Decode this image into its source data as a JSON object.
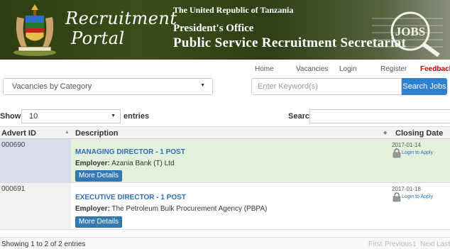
{
  "banner": {
    "portal_title_line1": "Recruitment",
    "portal_title_line2": "Portal",
    "gov_line1": "The United Republic of Tanzania",
    "gov_line2": "President's Office",
    "gov_line3": "Public Service Recruitment Secretariat",
    "jobs_art_text": "JOBS"
  },
  "nav": {
    "home": "Home",
    "vacancies": "Vacancies",
    "login": "Login",
    "register": "Register",
    "feedback": "Feedback"
  },
  "filters": {
    "category_selected": "Vacancies by Category",
    "keyword_placeholder": "Enter Keyword(s)",
    "search_button": "Search Jobs"
  },
  "table_controls": {
    "show_label": "Show",
    "page_length": "10",
    "entries_label": "entries",
    "search_label": "Search:"
  },
  "table": {
    "headers": {
      "advert_id": "Advert ID",
      "description": "Description",
      "closing_date": "Closing Date"
    },
    "rows": [
      {
        "advert_id": "000690",
        "title": "MANAGING DIRECTOR - 1 POST",
        "employer_label": "Employer:",
        "employer": "Azania Bank (T) Ltd",
        "more_details": "More Details",
        "closing_date": "2017-01-14",
        "login_to_apply": "Login to Apply"
      },
      {
        "advert_id": "000691",
        "title": "EXECUTIVE DIRECTOR - 1 POST",
        "employer_label": "Employer:",
        "employer": "The Petroleum Bulk Procurement Agency (PBPA)",
        "more_details": "More Details",
        "closing_date": "2017-01-18",
        "login_to_apply": "Login to Apply"
      }
    ]
  },
  "footer": {
    "info": "Showing 1 to 2 of 2 entries",
    "first": "First",
    "previous": "Previous",
    "page": "1",
    "next": "Next",
    "last": "Last"
  },
  "colors": {
    "accent_blue": "#2f80d1",
    "feedback_red": "#c40000",
    "row_highlight": "#e3f0db",
    "link_blue": "#2a6ebb"
  },
  "icons": [
    "coat-of-arms-emblem",
    "jobs-illustration",
    "lock-icon",
    "sort-icon",
    "chevron-down-icon"
  ]
}
